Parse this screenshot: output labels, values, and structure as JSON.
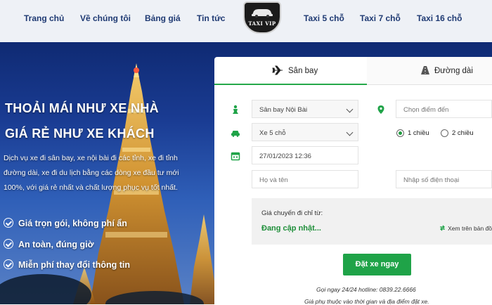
{
  "nav": {
    "items": [
      "Trang chủ",
      "Về chúng tôi",
      "Bảng giá",
      "Tin tức",
      "Taxi 5 chỗ",
      "Taxi 7 chỗ",
      "Taxi 16 chỗ"
    ],
    "logo_text": "TAXI VIP"
  },
  "hero": {
    "title_line1": "THOẢI MÁI NHƯ XE NHÀ",
    "title_line2": "GIÁ RẺ NHƯ XE KHÁCH",
    "description": "Dịch vụ xe đi sân bay, xe nội bài đi các tỉnh, xe đi tỉnh đường dài, xe đi du lịch bằng các dòng xe đầu tư mới 100%, với giá rẻ nhất và chất lượng phục vụ tốt nhất.",
    "features": [
      "Giá trọn gói, không phí ẩn",
      "An toàn, đúng giờ",
      "Miễn phí thay đổi thông tin"
    ]
  },
  "booking": {
    "tabs": {
      "airport": "Sân bay",
      "long_distance": "Đường dài"
    },
    "pickup_value": "Sân bay Nội Bài",
    "destination_placeholder": "Chọn điểm đến",
    "car_type_value": "Xe 5 chỗ",
    "trip_one_way": "1 chiều",
    "trip_round": "2 chiều",
    "datetime_value": "27/01/2023 12:36",
    "name_placeholder": "Họ và tên",
    "phone_placeholder": "Nhập số điện thoại",
    "price_label": "Giá chuyến đi chỉ từ:",
    "price_status": "Đang cập nhật...",
    "map_link": "Xem trên bản đồ",
    "submit_label": "Đặt xe ngay",
    "hotline_note": "Gọi ngay 24/24 hotline: 0839.22.6666",
    "time_note": "Giá phụ thuộc vào thời gian và địa điểm đặt xe."
  },
  "colors": {
    "nav_text": "#1f3a73",
    "accent_green": "#1fa348",
    "hero_blue": "#1a3c93"
  }
}
